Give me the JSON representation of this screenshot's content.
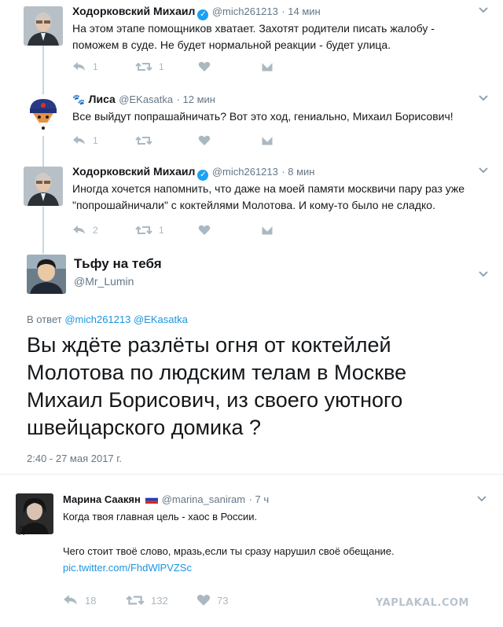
{
  "thread": [
    {
      "name": "Ходорковский Михаил",
      "handle": "@mich261213",
      "time": "· 14 мин",
      "text": "На этом этапе помощников хватает. Захотят родители писать жалобу - поможем в суде. Не будет нормальной реакции - будет улица.",
      "reply_count": "1",
      "retweet_count": "1",
      "like_count": ""
    },
    {
      "name": "Лиса",
      "handle": "@EKasatka",
      "time": "· 12 мин",
      "text": "Все выйдут попрашайничать?  Вот это ход, гениально, Михаил Борисович!",
      "reply_count": "1",
      "retweet_count": "",
      "like_count": ""
    },
    {
      "name": "Ходорковский Михаил",
      "handle": "@mich261213",
      "time": "· 8 мин",
      "text": "Иногда хочется напомнить, что даже на моей памяти москвичи пару раз уже \"попрошайничали\" с коктейлями Молотова. И кому-то было не сладко.",
      "reply_count": "2",
      "retweet_count": "1",
      "like_count": ""
    }
  ],
  "main": {
    "name": "Тьфу на тебя",
    "handle": "@Mr_Lumin",
    "reply_prefix": "В ответ",
    "reply_to_1": "@mich261213",
    "reply_to_2": "@EKasatka",
    "text": "Вы ждёте разлёты огня от коктейлей Молотова по людским телам в Москве Михаил Борисович, из своего уютного швейцарского домика ?",
    "timestamp": "2:40 - 27 мая 2017 г."
  },
  "reply": {
    "name": "Марина Саакян",
    "handle": "@marina_saniram",
    "time": "· 7 ч",
    "line1": "Когда твоя главная цель - хаос в России.",
    "line2": "Чего стоит твоё слово, мразь,если ты сразу нарушил своё обещание.",
    "link": "pic.twitter.com/FhdWlPVZSc",
    "reply_count": "18",
    "retweet_count": "132",
    "like_count": "73"
  },
  "watermark": "YAPLAKAL.COM",
  "colors": {
    "link": "#1b95e0",
    "verified": "#1da1f2",
    "watermark": "#b9c3cc",
    "thread_line": "#c7d8e5"
  },
  "icons": [
    "reply-icon",
    "retweet-icon",
    "like-icon",
    "dm-icon",
    "verified-icon",
    "chevron-down-icon",
    "russia-flag-icon",
    "paw-icon"
  ]
}
